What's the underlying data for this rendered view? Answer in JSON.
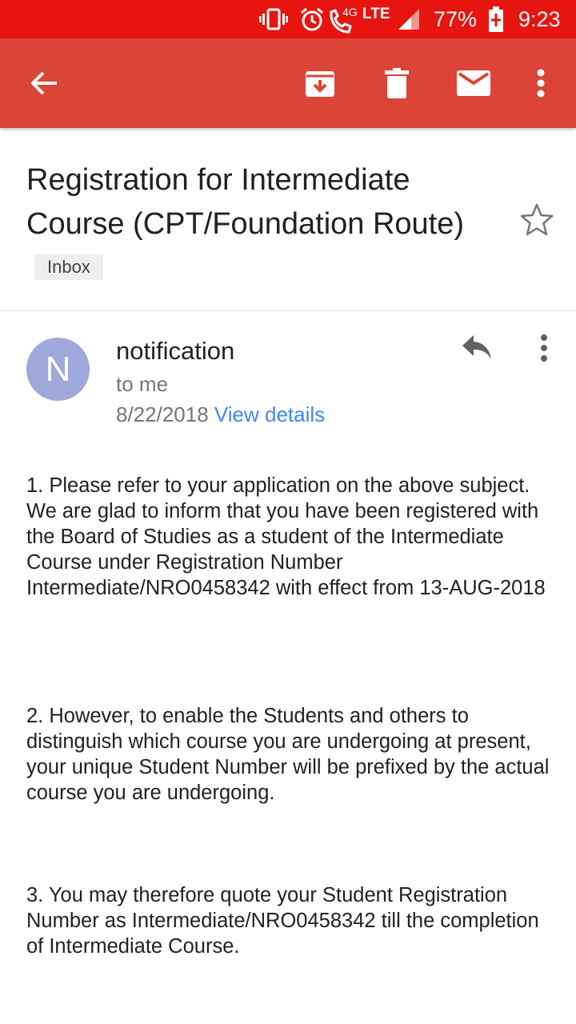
{
  "status_bar": {
    "network": "4G",
    "lte": "LTE",
    "battery_percent": "77%",
    "time": "9:23",
    "icons": [
      "vibrate-icon",
      "alarm-icon",
      "volte-call-icon",
      "signal-icon",
      "battery-charging-icon"
    ]
  },
  "app_bar": {
    "color": "#db4437",
    "actions": [
      "back-arrow-icon",
      "archive-icon",
      "delete-icon",
      "mark-unread-icon",
      "more-vert-icon"
    ]
  },
  "email": {
    "subject": "Registration for Intermediate Course (CPT/Foundation Route)",
    "label": "Inbox",
    "sender": {
      "avatar_letter": "N",
      "avatar_color": "#9fa8da",
      "name": "notification",
      "to": "to me",
      "date": "8/22/2018",
      "view_details": "View details"
    },
    "body": [
      "1. Please refer to your application on the above subject. We are glad to inform that you have been registered with the Board of Studies as a student of the Intermediate Course under Registration Number Intermediate/NRO0458342 with effect from 13-AUG-2018",
      "2. However, to enable the Students and others to distinguish which course you are undergoing at present, your unique Student Number will be prefixed by the actual course you are undergoing.",
      "3. You may therefore quote your Student Registration Number as Intermediate/NRO0458342 till the completion of Intermediate Course."
    ]
  }
}
